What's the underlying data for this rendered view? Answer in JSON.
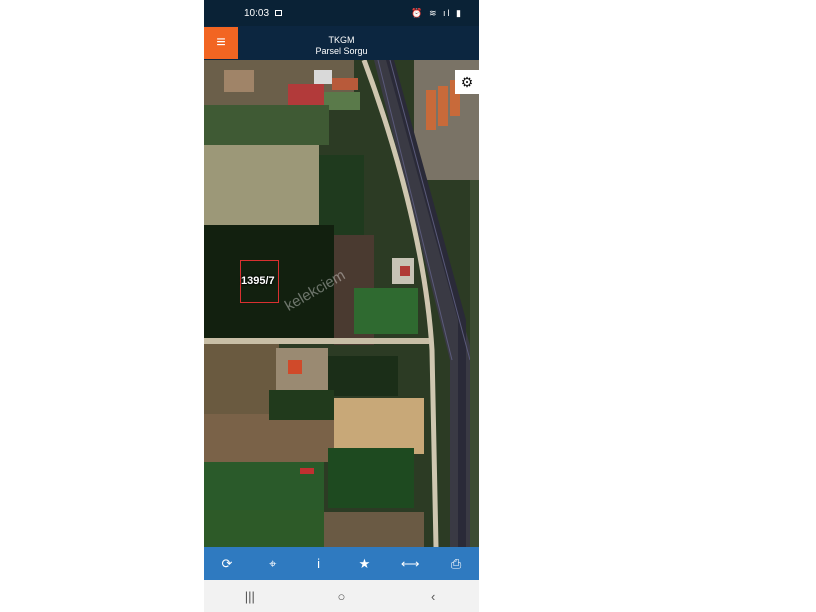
{
  "status_bar": {
    "time": "10:03",
    "icons": "⏰ ≋ ıl ▮"
  },
  "header": {
    "title": "TKGM",
    "subtitle": "Parsel Sorgu",
    "menu_icon": "≡"
  },
  "map": {
    "parcel_label": "1395/7",
    "watermark": "kelekciem",
    "settings_icon": "⚙"
  },
  "toolbar": {
    "refresh_icon": "⟳",
    "locate_icon": "⌖",
    "info_icon": "i",
    "favorite_icon": "★",
    "measure_icon": "⟷",
    "print_icon": "⎙"
  },
  "nav": {
    "recent_icon": "|||",
    "home_icon": "○",
    "back_icon": "‹"
  },
  "colors": {
    "header_bg": "#0c2640",
    "menu_accent": "#f26522",
    "toolbar_bg": "#2f7ac0",
    "parcel_outline": "#d93030"
  }
}
